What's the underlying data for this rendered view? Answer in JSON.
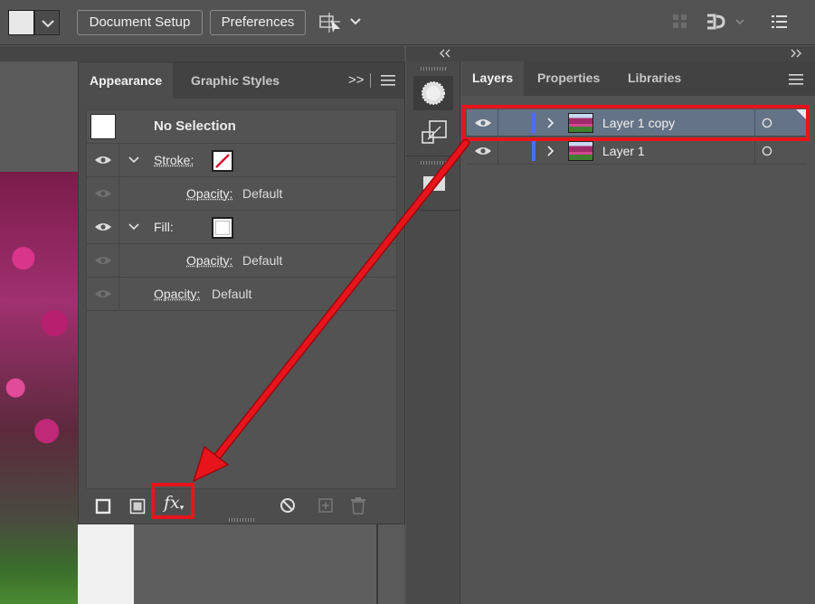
{
  "toolbar": {
    "document_setup_label": "Document Setup",
    "preferences_label": "Preferences",
    "fill_swatch_color": "#e8e8e8"
  },
  "appearance_panel": {
    "tabs": [
      {
        "label": "Appearance",
        "active": true
      },
      {
        "label": "Graphic Styles",
        "active": false
      }
    ],
    "overflow_label": ">>",
    "selection_label": "No Selection",
    "rows": [
      {
        "label": "Stroke:",
        "indent": 1,
        "visible": true
      },
      {
        "label": "Opacity:",
        "value": "Default",
        "indent": 2,
        "visible": false
      },
      {
        "label": "Fill:",
        "indent": 1,
        "visible": true
      },
      {
        "label": "Opacity:",
        "value": "Default",
        "indent": 2,
        "visible": false
      },
      {
        "label": "Opacity:",
        "value": "Default",
        "indent": 1,
        "visible": false
      }
    ],
    "fx_label": "fx"
  },
  "layers_panel": {
    "tabs": [
      {
        "label": "Layers",
        "active": true
      },
      {
        "label": "Properties",
        "active": false
      },
      {
        "label": "Libraries",
        "active": false
      }
    ],
    "layers": [
      {
        "name": "Layer 1 copy",
        "selected": true,
        "color": "#4b6ef5"
      },
      {
        "name": "Layer 1",
        "selected": false,
        "color": "#4b6ef5"
      }
    ]
  },
  "colors": {
    "highlight": "#e8141c",
    "selection": "#657387",
    "layer_color": "#4b6ef5"
  }
}
